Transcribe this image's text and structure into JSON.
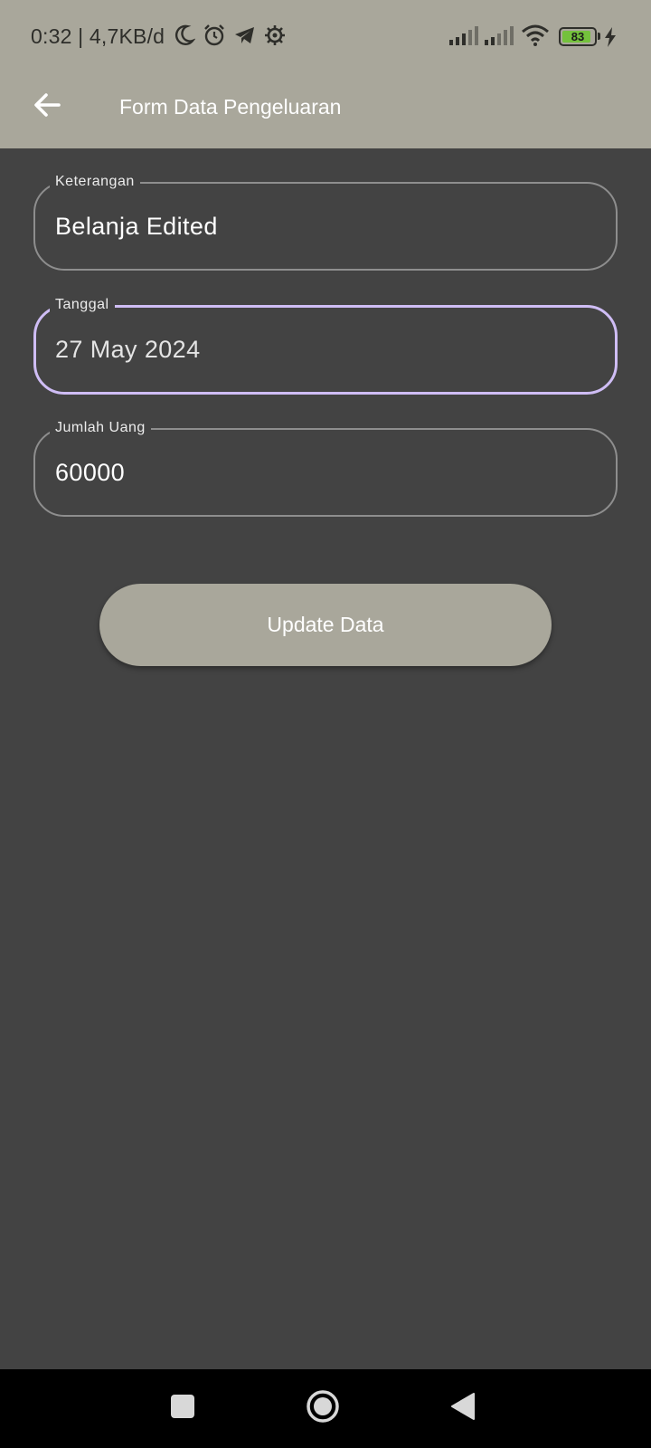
{
  "status_bar": {
    "time": "0:32 | 4,7KB/d",
    "battery_level": "83",
    "icons": [
      "moon-icon",
      "alarm-icon",
      "telegram-icon",
      "settings-gear-icon",
      "signal-icon",
      "signal-icon",
      "wifi-icon",
      "battery-icon",
      "charging-icon"
    ]
  },
  "app_bar": {
    "title": "Form Data Pengeluaran",
    "back_icon": "arrow-left-icon"
  },
  "form": {
    "keterangan": {
      "label": "Keterangan",
      "value": "Belanja Edited"
    },
    "tanggal": {
      "label": "Tanggal",
      "value": "27 May 2024"
    },
    "jumlah": {
      "label": "Jumlah Uang",
      "value": "60000"
    },
    "submit_label": "Update Data"
  },
  "colors": {
    "primary": "#a9a79b",
    "background": "#434343",
    "focus_border": "#cfbdf5",
    "battery_fill": "#74c23c"
  },
  "nav_bar": {
    "icons": [
      "recents-square-icon",
      "home-circle-icon",
      "back-triangle-icon"
    ]
  }
}
